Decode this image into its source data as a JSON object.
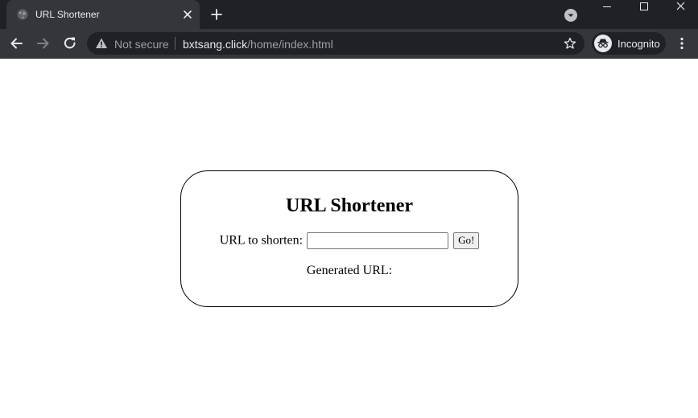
{
  "colors": {
    "tabstrip_bg": "#202124",
    "toolbar_bg": "#35363a",
    "omnibox_bg": "#202124",
    "chrome_text": "#e8eaed",
    "chrome_muted": "#9aa0a6",
    "page_bg": "#ffffff"
  },
  "tab": {
    "title": "URL Shortener",
    "favicon": "globe-icon"
  },
  "toolbar": {
    "security_label": "Not secure",
    "url_host": "bxtsang.click",
    "url_path": "/home/index.html",
    "profile_label": "Incognito"
  },
  "page": {
    "title": "URL Shortener",
    "input_label": "URL to shorten:",
    "input_value": "",
    "button_label": "Go!",
    "generated_label": "Generated URL:"
  }
}
